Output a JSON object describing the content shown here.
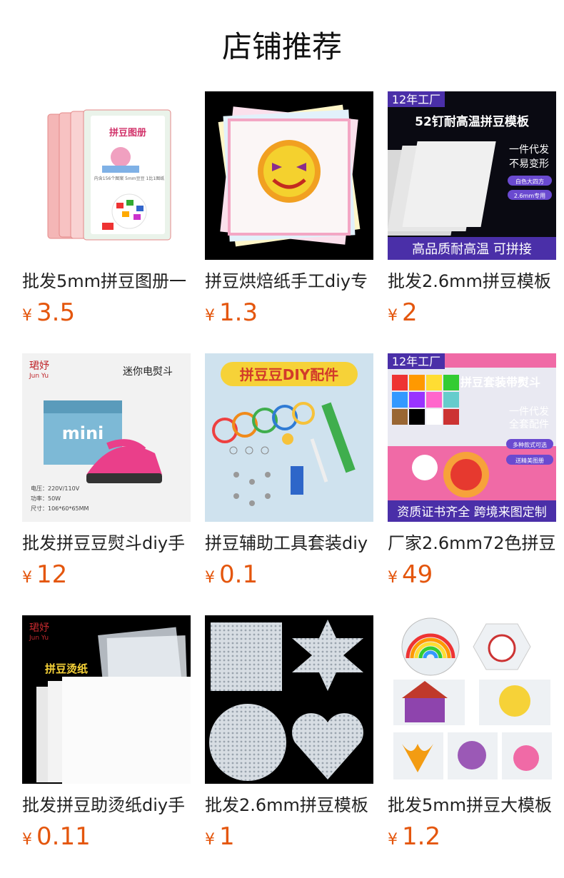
{
  "section_title": "店铺推荐",
  "currency": "¥",
  "products": [
    {
      "name": "批发5mm拼豆图册一",
      "price": "3.5",
      "image": {
        "banner": "拼豆图册",
        "sub": "内含156个图案 5mm豆豆 1比1图纸"
      }
    },
    {
      "name": "拼豆烘焙纸手工diy专",
      "price": "1.3",
      "image": {}
    },
    {
      "name": "批发2.6mm拼豆模板",
      "price": "2",
      "image": {
        "tag": "12年工厂",
        "headline": "52钉耐高温拼豆模板",
        "badge1": "一件代发",
        "badge2": "不易变形",
        "chip1": "白色大四方",
        "chip2": "2.6mm专用",
        "footer": "高品质耐高温  可拼接"
      }
    },
    {
      "name": "批发拼豆豆熨斗diy手",
      "price": "12",
      "image": {
        "brand": "珺妤",
        "brand_en": "Jun Yu",
        "headline": "迷你电熨斗",
        "box": "mini",
        "spec1": "电压：220V/110V",
        "spec2": "功率：50W",
        "spec3": "尺寸：106*60*65MM"
      }
    },
    {
      "name": "拼豆辅助工具套装diy",
      "price": "0.1",
      "image": {
        "headline": "拼豆豆DIY配件"
      }
    },
    {
      "name": "厂家2.6mm72色拼豆",
      "price": "49",
      "image": {
        "tag": "12年工厂",
        "headline": "拼豆套装带熨斗",
        "badge1": "一件代发",
        "badge2": "全套配件",
        "chip1": "多种款式可选",
        "chip2": "送精美图册",
        "footer": "资质证书齐全 跨境来图定制"
      }
    },
    {
      "name": "批发拼豆助烫纸diy手",
      "price": "0.11",
      "image": {
        "brand": "珺妤",
        "brand_en": "Jun Yu",
        "headline": "拼豆烫纸"
      }
    },
    {
      "name": "批发2.6mm拼豆模板",
      "price": "1",
      "image": {}
    },
    {
      "name": "批发5mm拼豆大模板",
      "price": "1.2",
      "image": {}
    }
  ],
  "colors": {
    "price": "#e4560d",
    "tag_bg": "#4a2fa8",
    "footer_bg": "#4a2fa8"
  }
}
